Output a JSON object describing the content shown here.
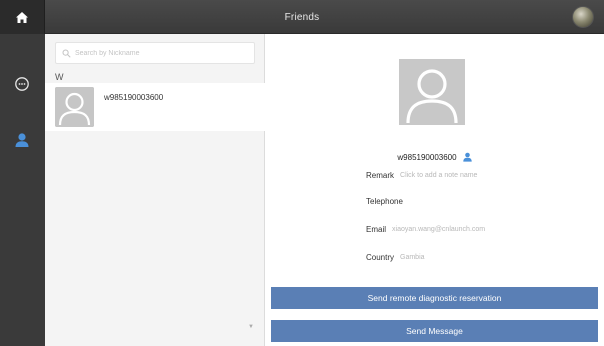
{
  "header": {
    "title": "Friends",
    "home_icon": "home-icon",
    "profile_icon": "user-avatar"
  },
  "sidebar": {
    "items": [
      {
        "icon": "chat-icon",
        "selected": false
      },
      {
        "icon": "contacts-icon",
        "selected": true
      }
    ]
  },
  "contacts": {
    "search_placeholder": "Search by Nickname",
    "section_letter": "W",
    "items": [
      {
        "name": "w985190003600"
      }
    ]
  },
  "detail": {
    "name": "w985190003600",
    "fields": {
      "remark_label": "Remark",
      "remark_value": "Click to add a note name",
      "telephone_label": "Telephone",
      "telephone_value": "",
      "email_label": "Email",
      "email_value": "xiaoyan.wang@cnlaunch.com",
      "country_label": "Country",
      "country_value": "Gambia"
    },
    "buttons": {
      "reservation": "Send remote diagnostic reservation",
      "message": "Send Message"
    }
  },
  "colors": {
    "button_bg": "#5a7fb5",
    "topbar_bg": "#444444",
    "sidebar_bg": "#3a3a3a",
    "accent_icon": "#4a90d9"
  }
}
